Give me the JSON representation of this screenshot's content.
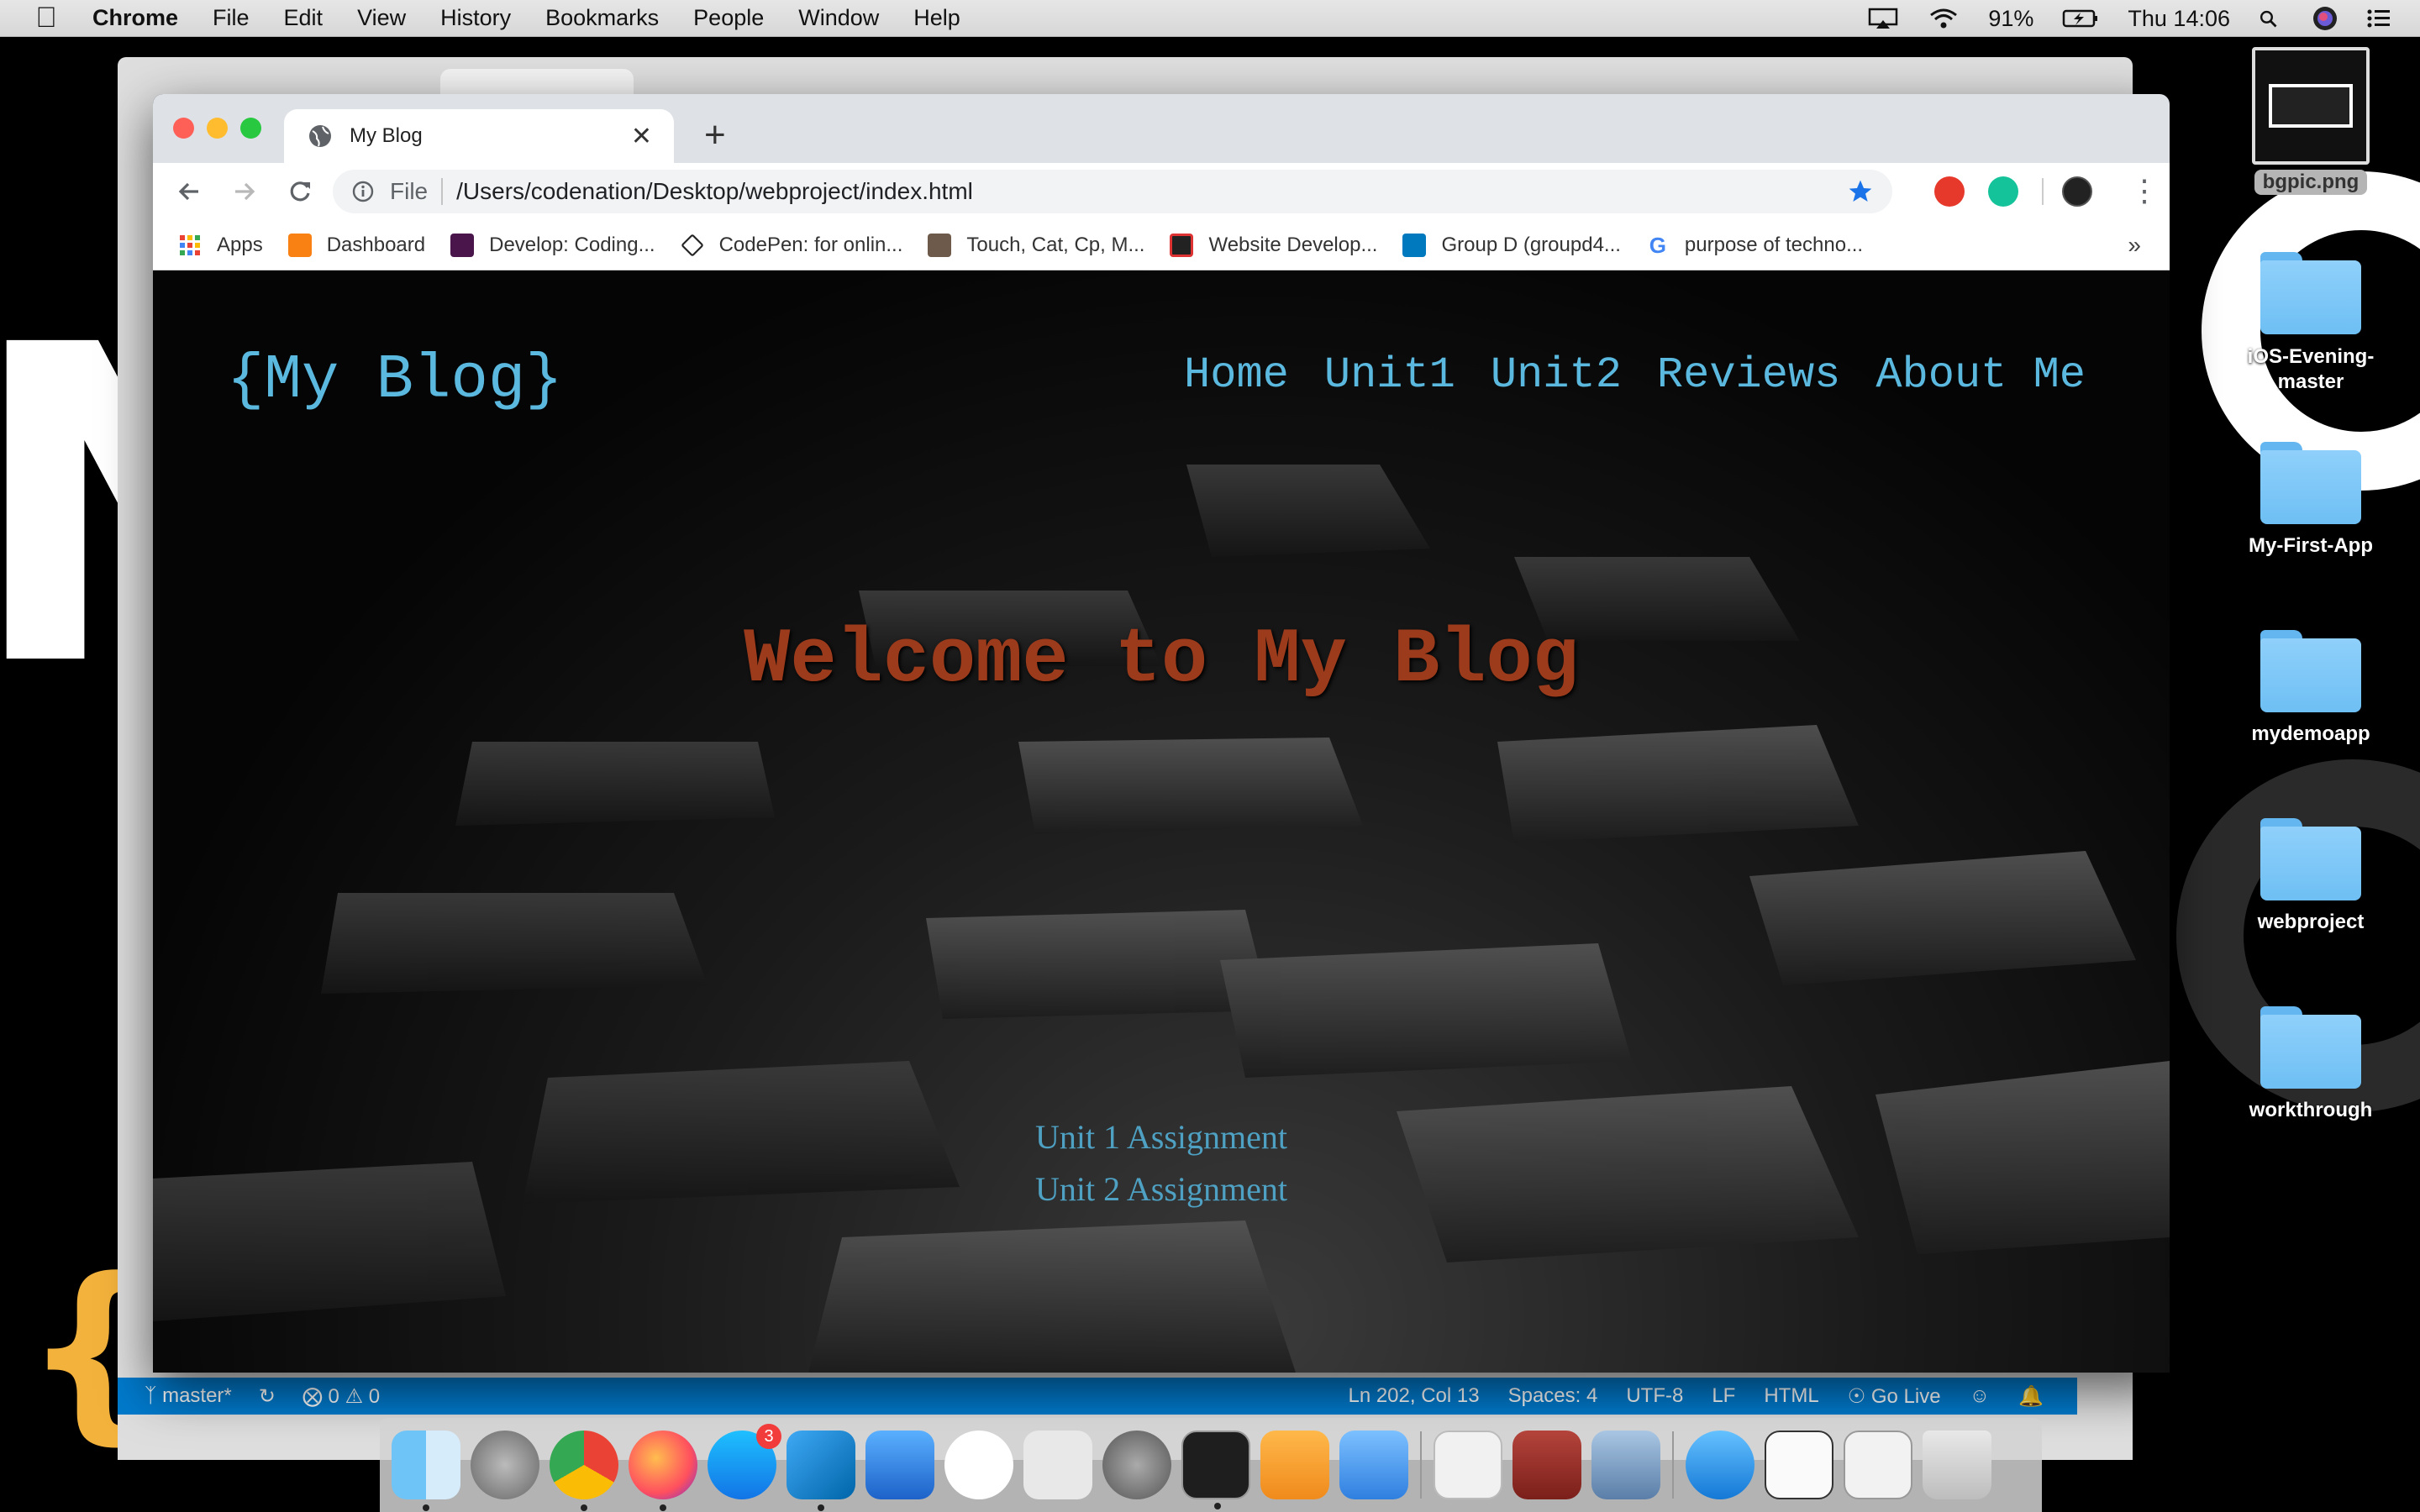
{
  "menubar": {
    "app_name": "Chrome",
    "menus": [
      "File",
      "Edit",
      "View",
      "History",
      "Bookmarks",
      "People",
      "Window",
      "Help"
    ],
    "battery": "91%",
    "clock": "Thu 14:06"
  },
  "desktop": {
    "icons": [
      {
        "label": "bgpic.png",
        "kind": "image"
      },
      {
        "label": "iOS-Evening-master",
        "kind": "folder"
      },
      {
        "label": "My-First-App",
        "kind": "folder"
      },
      {
        "label": "mydemoapp",
        "kind": "folder"
      },
      {
        "label": "webproject",
        "kind": "folder"
      },
      {
        "label": "workthrough",
        "kind": "folder"
      }
    ]
  },
  "browser": {
    "tab_title": "My Blog",
    "address_scheme": "File",
    "address_url": "/Users/codenation/Desktop/webproject/index.html",
    "bookmarks": [
      "Apps",
      "Dashboard",
      "Develop: Coding...",
      "CodePen: for onlin...",
      "Touch, Cat, Cp, M...",
      "Website Develop...",
      "Group D (groupd4...",
      "purpose of techno..."
    ],
    "bookmarks_overflow": "»"
  },
  "blog": {
    "logo": "{My Blog}",
    "nav": [
      "Home",
      "Unit1",
      "Unit2",
      "Reviews",
      "About Me"
    ],
    "heading": "Welcome to My Blog",
    "links": [
      "Unit 1 Assignment",
      "Unit 2 Assignment"
    ]
  },
  "vscode_status": {
    "branch": "master*",
    "errors": "0",
    "warnings": "0",
    "position": "Ln 202, Col 13",
    "spaces": "Spaces: 4",
    "encoding": "UTF-8",
    "eol": "LF",
    "language": "HTML",
    "live": "Go Live"
  },
  "dock": {
    "appstore_badge": "3"
  },
  "colors": {
    "blog_link": "#5bb8de",
    "blog_heading": "#9b3b1c",
    "vscode_blue": "#007acc"
  }
}
